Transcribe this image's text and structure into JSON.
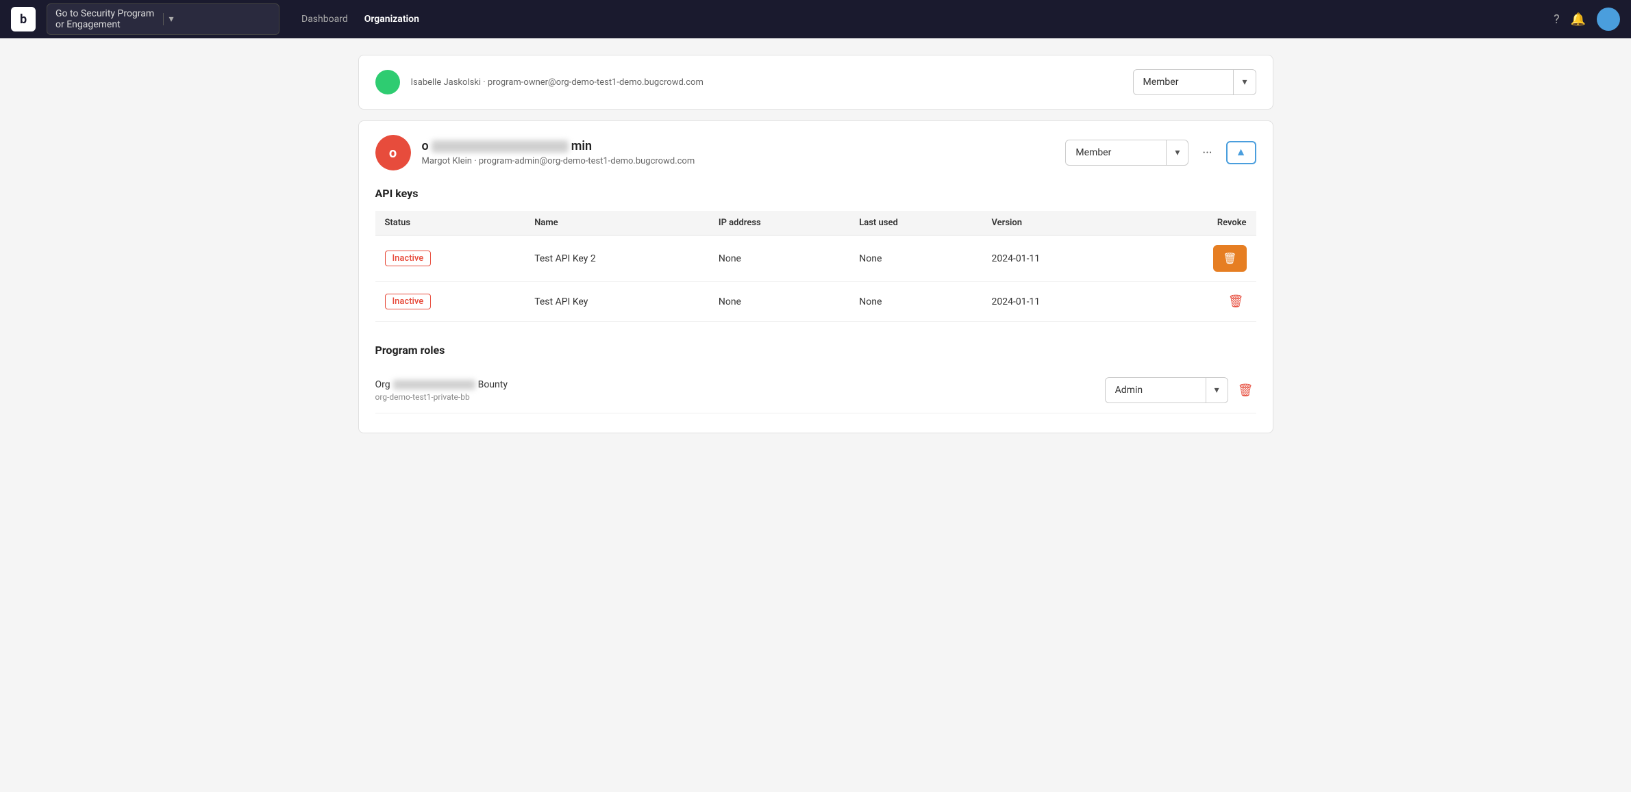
{
  "navbar": {
    "logo_text": "b",
    "dropdown_label": "Go to Security Program or Engagement",
    "nav_items": [
      {
        "label": "Dashboard",
        "active": false
      },
      {
        "label": "Organization",
        "active": true
      }
    ],
    "help_icon": "?",
    "bell_icon": "🔔"
  },
  "prev_user": {
    "name_prefix": "Isabelle Jaskolski",
    "email": "program-owner@org-demo-test1-demo.bugcrowd.com"
  },
  "user_card": {
    "name_prefix": "o",
    "name_blur": true,
    "name_suffix": "min",
    "sub_name": "Margot Klein",
    "email": "program-admin@org-demo-test1-demo.bugcrowd.com",
    "role_label": "Member",
    "more_button": "···",
    "collapse_icon": "▲",
    "api_keys_section_title": "API keys",
    "api_table": {
      "columns": [
        "Status",
        "Name",
        "IP address",
        "Last used",
        "Version",
        "Revoke"
      ],
      "rows": [
        {
          "status": "Inactive",
          "name": "Test API Key 2",
          "ip": "None",
          "last_used": "None",
          "version": "2024-01-11",
          "highlighted": true
        },
        {
          "status": "Inactive",
          "name": "Test API Key",
          "ip": "None",
          "last_used": "None",
          "version": "2024-01-11",
          "highlighted": false
        }
      ]
    },
    "program_roles_section_title": "Program roles",
    "program_roles": [
      {
        "name_prefix": "Org",
        "name_blur": true,
        "name_suffix": "Bounty",
        "sub": "org-demo-test1-private-bb",
        "role": "Admin"
      }
    ]
  },
  "icons": {
    "chevron_down": "▾",
    "trash": "🗑",
    "more": "···",
    "collapse": "▲",
    "expand": "▼"
  }
}
